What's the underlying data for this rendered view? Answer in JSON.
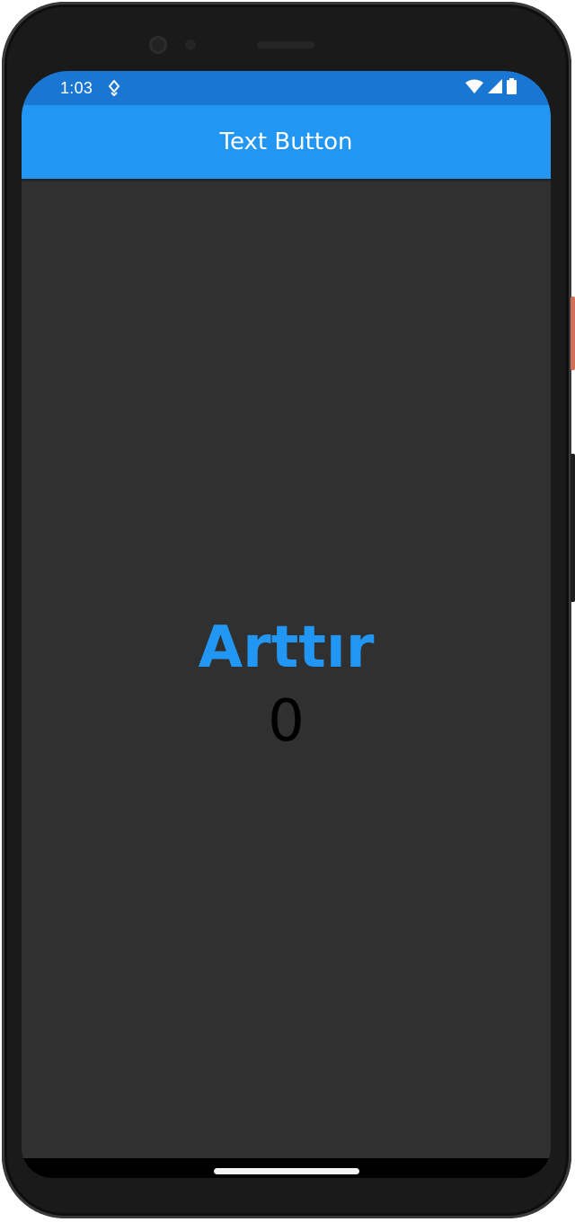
{
  "status_bar": {
    "time": "1:03",
    "icons": [
      "notification-icon",
      "wifi-icon",
      "signal-icon",
      "battery-icon"
    ]
  },
  "app_bar": {
    "title": "Text Button",
    "color": "#2196f3"
  },
  "main": {
    "button_label": "Arttır",
    "counter_value": "0"
  },
  "colors": {
    "status_bar": "#1976d2",
    "background": "#303030",
    "accent": "#2196f3"
  }
}
